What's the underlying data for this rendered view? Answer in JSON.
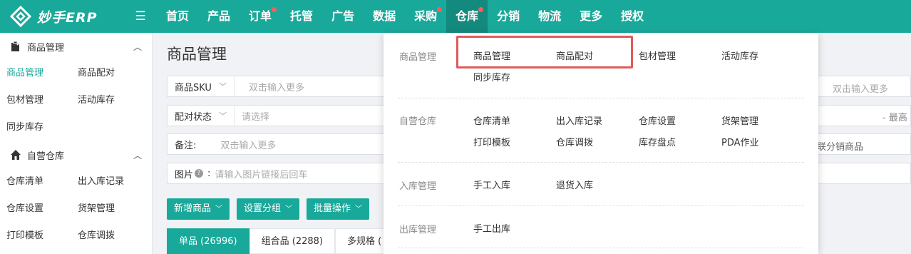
{
  "brand": {
    "name": "妙手ERP"
  },
  "nav": {
    "items": [
      {
        "label": "首页",
        "dot": false,
        "active": false
      },
      {
        "label": "产品",
        "dot": false,
        "active": false
      },
      {
        "label": "订单",
        "dot": true,
        "active": false
      },
      {
        "label": "托管",
        "dot": false,
        "active": false
      },
      {
        "label": "广告",
        "dot": false,
        "active": false
      },
      {
        "label": "数据",
        "dot": false,
        "active": false
      },
      {
        "label": "采购",
        "dot": true,
        "active": false
      },
      {
        "label": "仓库",
        "dot": true,
        "active": true
      },
      {
        "label": "分销",
        "dot": false,
        "active": false
      },
      {
        "label": "物流",
        "dot": false,
        "active": false
      },
      {
        "label": "更多",
        "dot": false,
        "active": false
      },
      {
        "label": "授权",
        "dot": false,
        "active": false
      }
    ]
  },
  "sidebar": {
    "groups": [
      {
        "title": "商品管理",
        "icon": "clipboard-icon",
        "items": [
          "商品管理",
          "商品配对",
          "包材管理",
          "活动库存",
          "同步库存"
        ],
        "active": "商品管理"
      },
      {
        "title": "自营仓库",
        "icon": "home-icon",
        "items": [
          "仓库清单",
          "出入库记录",
          "仓库设置",
          "货架管理",
          "打印模板",
          "仓库调拨"
        ]
      }
    ]
  },
  "main": {
    "title": "商品管理",
    "filters": {
      "sku_label": "商品SKU",
      "sku_placeholder": "双击输入更多",
      "pair_label": "配对状态",
      "pair_placeholder": "请选择",
      "remark_label": "备注:",
      "remark_placeholder": "双击输入更多",
      "image_label": "图片",
      "image_placeholder": "请输入图片链接后回车",
      "right_placeholder1": "双击输入更多",
      "right_range": "-  最高",
      "right_text3": "联分销商品"
    },
    "buttons": [
      "新增商品",
      "设置分组",
      "批量操作"
    ],
    "tabs": [
      "单品 (26996)",
      "组合品 (2288)",
      "多规格 ("
    ]
  },
  "dropdown": {
    "sections": [
      {
        "title": "商品管理",
        "links": [
          "商品管理",
          "商品配对",
          "包材管理",
          "活动库存",
          "同步库存"
        ]
      },
      {
        "title": "自营仓库",
        "links": [
          "仓库清单",
          "出入库记录",
          "仓库设置",
          "货架管理",
          "打印模板",
          "仓库调拨",
          "库存盘点",
          "PDA作业"
        ]
      },
      {
        "title": "入库管理",
        "links": [
          "手工入库",
          "退货入库"
        ]
      },
      {
        "title": "出库管理",
        "links": [
          "手工出库"
        ]
      }
    ]
  },
  "colors": {
    "accent": "#19a99a",
    "accent_dark": "#14897d",
    "highlight": "#e05a5a",
    "badge": "#ff5b5b"
  }
}
